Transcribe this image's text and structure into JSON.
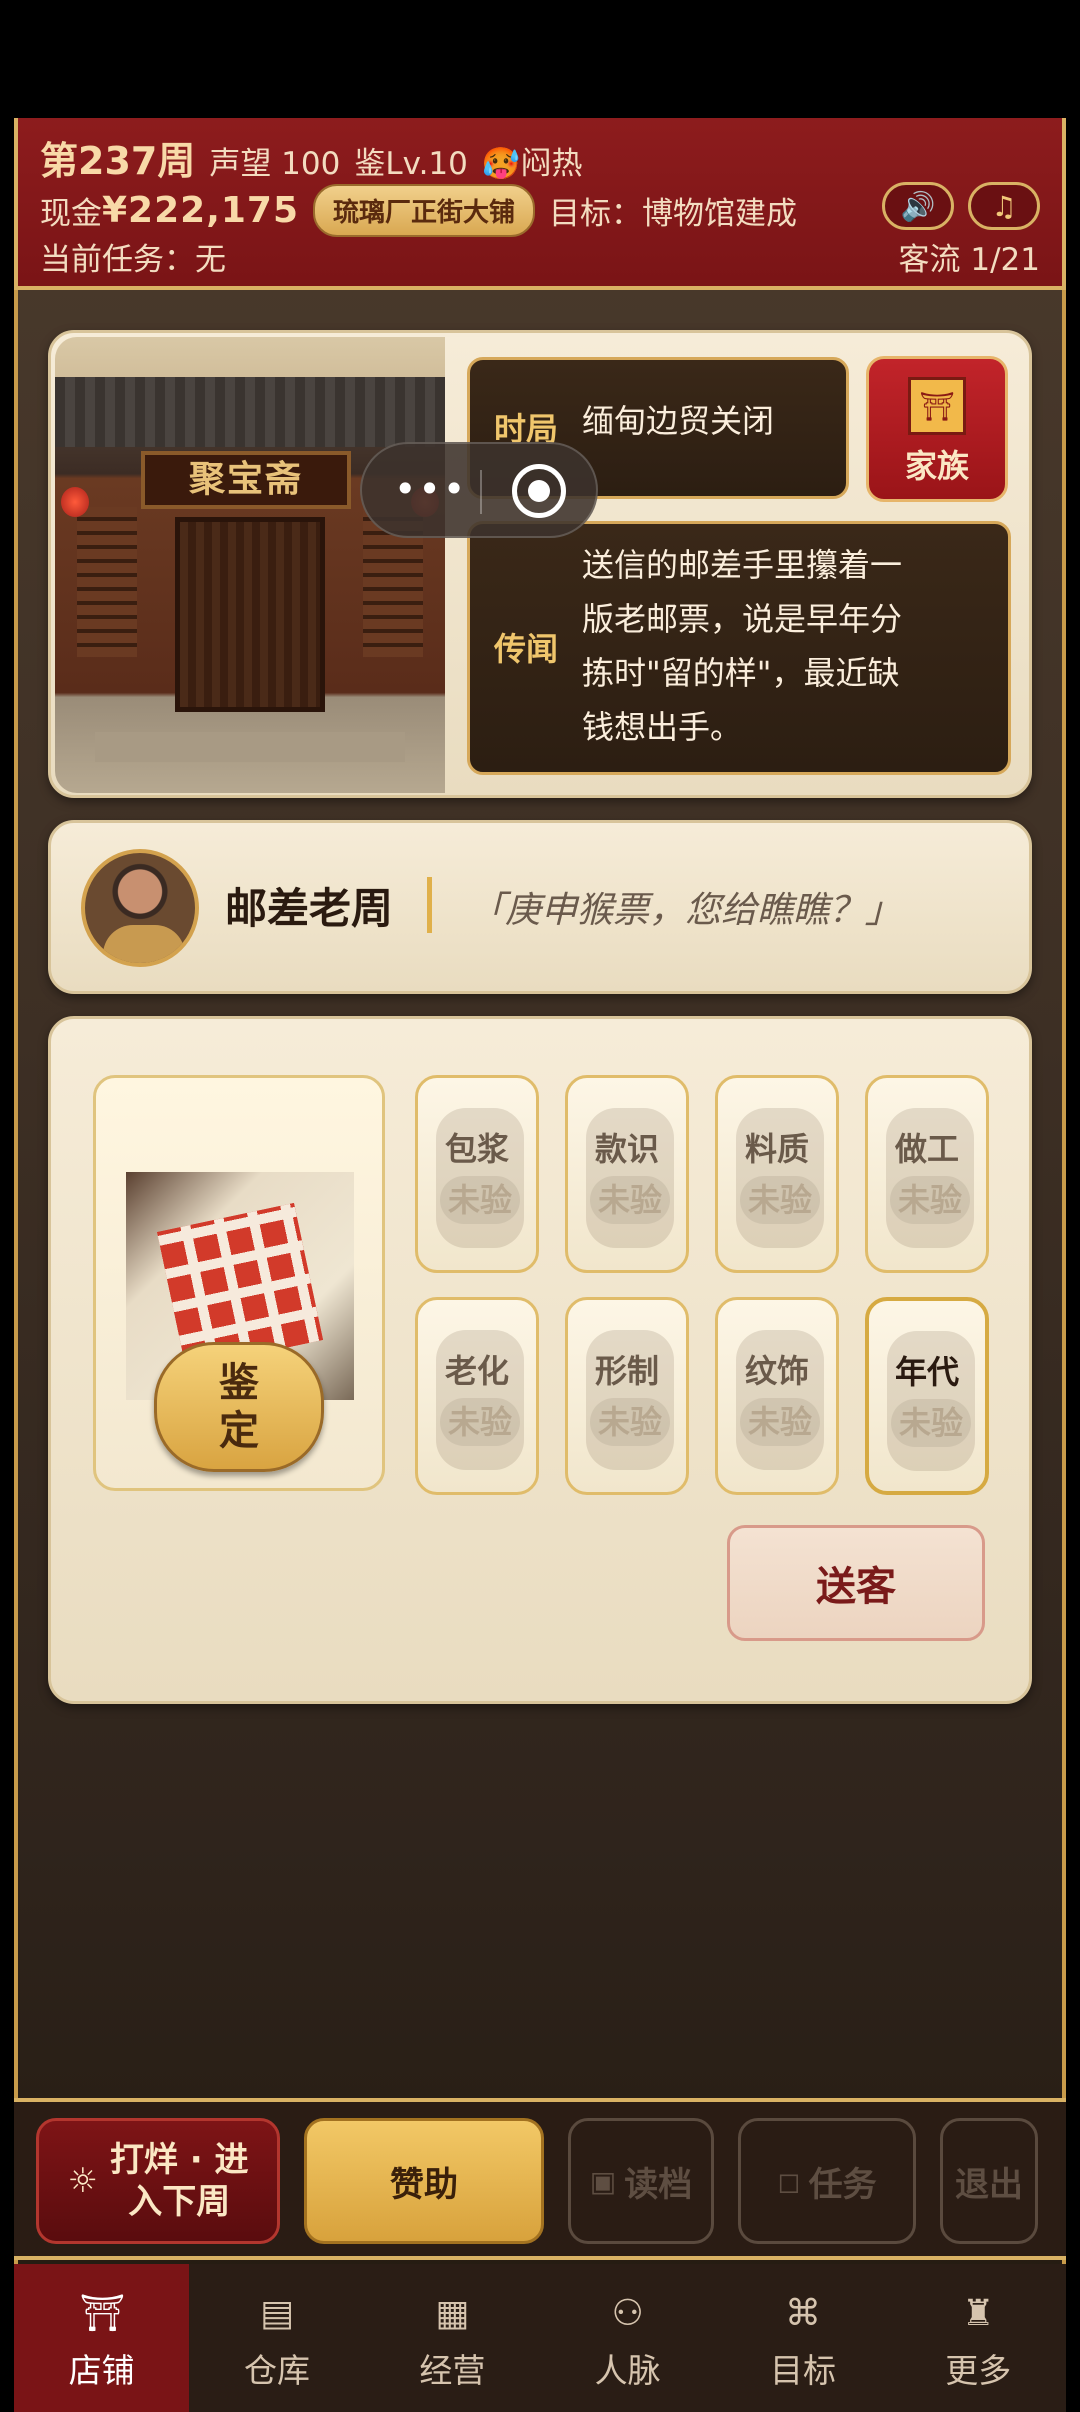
{
  "header": {
    "week": "第237周",
    "reputation": "声望 100",
    "level": "鉴Lv.10",
    "weather": "🥵闷热",
    "cash_label": "现金",
    "cash": "¥222,175",
    "location": "琉璃厂正街大铺",
    "goal": "目标：博物馆建成",
    "task": "当前任务：无",
    "flow": "客流 1/21",
    "sound_icon": "speaker-icon",
    "music_icon": "music-note-icon"
  },
  "shop": {
    "plaque": "聚宝斋"
  },
  "news": {
    "situation_tag": "时局",
    "situation_text": "缅甸边贸关闭",
    "rumor_tag": "传闻",
    "rumor_lines": [
      "送信的邮差手里攥着一",
      "版老邮票，说是早年分",
      "拣时\"留的样\"，最近缺",
      "钱想出手。"
    ]
  },
  "family_button": "家族",
  "customer": {
    "name": "邮差老周",
    "quote": "「庚申猴票，您给瞧瞧？」"
  },
  "appraise": {
    "button_line1": "鉴",
    "button_line2": "定",
    "attributes": [
      {
        "label": "包浆",
        "status": "未验"
      },
      {
        "label": "款识",
        "status": "未验"
      },
      {
        "label": "料质",
        "status": "未验"
      },
      {
        "label": "做工",
        "status": "未验"
      },
      {
        "label": "老化",
        "status": "未验"
      },
      {
        "label": "形制",
        "status": "未验"
      },
      {
        "label": "纹饰",
        "status": "未验"
      },
      {
        "label": "年代",
        "status": "未验"
      }
    ],
    "send_off": "送客"
  },
  "actions": {
    "next_week_line1": "打烊 · 进",
    "next_week_line2": "入下周",
    "sponsor": "赞助",
    "load": "读档",
    "task": "任务",
    "exit": "退出"
  },
  "nav": [
    {
      "label": "店铺",
      "icon": "shop-icon"
    },
    {
      "label": "仓库",
      "icon": "warehouse-icon"
    },
    {
      "label": "经营",
      "icon": "abacus-icon"
    },
    {
      "label": "人脉",
      "icon": "people-icon"
    },
    {
      "label": "目标",
      "icon": "scroll-icon"
    },
    {
      "label": "更多",
      "icon": "more-icon"
    }
  ],
  "colors": {
    "header_red": "#7a1416",
    "gold": "#d9b264",
    "card_cream": "#f6ecd8"
  }
}
